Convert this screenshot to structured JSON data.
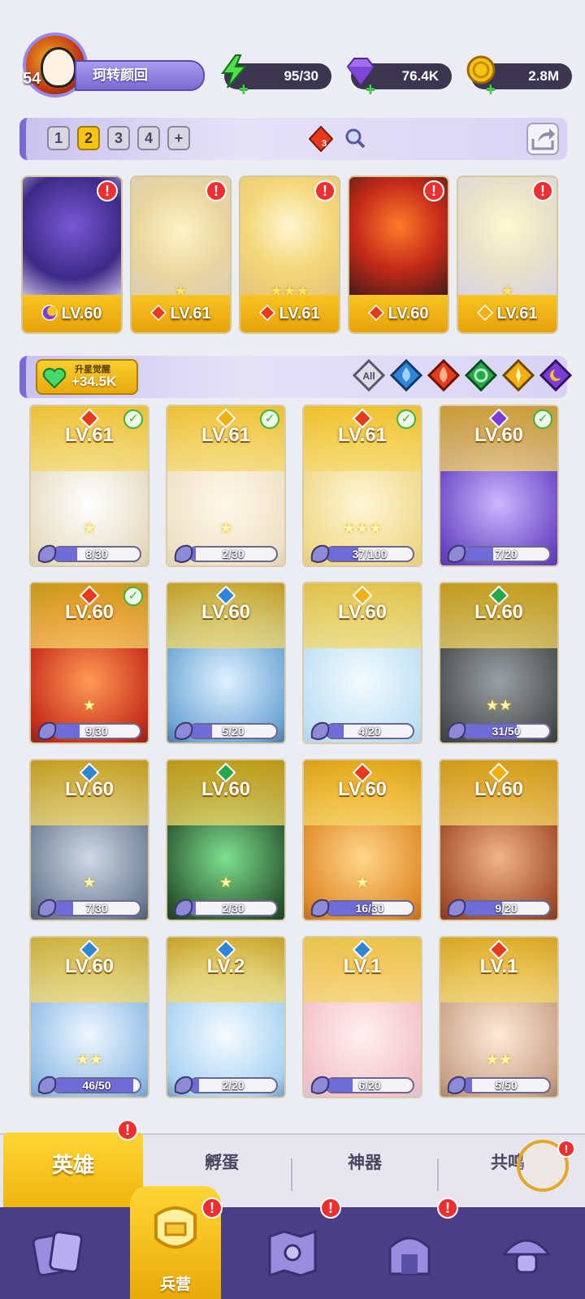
{
  "player": {
    "level": "54",
    "name": "珂转颜回"
  },
  "resources": [
    {
      "name": "energy",
      "icon": "lightning-icon",
      "value": "95/30"
    },
    {
      "name": "gems",
      "icon": "diamond-icon",
      "value": "76.4K"
    },
    {
      "name": "gold",
      "icon": "coin-icon",
      "value": "2.8M"
    }
  ],
  "team_panel": {
    "tabs": [
      "1",
      "2",
      "3",
      "4",
      "+"
    ],
    "active_tab": "2",
    "element_count": "3",
    "members": [
      {
        "element": "dark",
        "level": "LV.60",
        "stars": "",
        "alert": "!"
      },
      {
        "element": "fire",
        "level": "LV.61",
        "stars": "★",
        "alert": "!"
      },
      {
        "element": "fire",
        "level": "LV.61",
        "stars": "★★★",
        "alert": "!"
      },
      {
        "element": "fire",
        "level": "LV.60",
        "stars": "",
        "alert": "!"
      },
      {
        "element": "light",
        "level": "LV.61",
        "stars": "★",
        "alert": "!"
      }
    ]
  },
  "filter": {
    "awake_title": "升星觉醒",
    "awake_value": "+34.5K",
    "all_label": "All",
    "elements": [
      "water",
      "fire",
      "wind",
      "light",
      "dark"
    ]
  },
  "heroes": [
    {
      "element": "fire",
      "level": "LV.61",
      "shards": "8/30",
      "progress": 0.27,
      "checked": true,
      "stars": "★"
    },
    {
      "element": "light",
      "level": "LV.61",
      "shards": "2/30",
      "progress": 0.07,
      "checked": true,
      "stars": "★"
    },
    {
      "element": "fire",
      "level": "LV.61",
      "shards": "37/100",
      "progress": 0.37,
      "checked": true,
      "stars": "★★★"
    },
    {
      "element": "dark",
      "level": "LV.60",
      "shards": "7/20",
      "progress": 0.35,
      "checked": true,
      "stars": ""
    },
    {
      "element": "fire",
      "level": "LV.60",
      "shards": "9/30",
      "progress": 0.3,
      "checked": true,
      "stars": "★"
    },
    {
      "element": "water",
      "level": "LV.60",
      "shards": "5/20",
      "progress": 0.25,
      "checked": false,
      "stars": ""
    },
    {
      "element": "light",
      "level": "LV.60",
      "shards": "4/20",
      "progress": 0.2,
      "checked": false,
      "stars": ""
    },
    {
      "element": "wind",
      "level": "LV.60",
      "shards": "31/50",
      "progress": 0.62,
      "checked": false,
      "stars": "★★"
    },
    {
      "element": "water",
      "level": "LV.60",
      "shards": "7/30",
      "progress": 0.23,
      "checked": false,
      "stars": "★"
    },
    {
      "element": "wind",
      "level": "LV.60",
      "shards": "2/30",
      "progress": 0.07,
      "checked": false,
      "stars": "★"
    },
    {
      "element": "fire",
      "level": "LV.60",
      "shards": "16/30",
      "progress": 0.53,
      "checked": false,
      "stars": "★"
    },
    {
      "element": "light",
      "level": "LV.60",
      "shards": "9/20",
      "progress": 0.45,
      "checked": false,
      "stars": ""
    },
    {
      "element": "water",
      "level": "LV.60",
      "shards": "46/50",
      "progress": 0.92,
      "checked": false,
      "stars": "★★"
    },
    {
      "element": "water",
      "level": "LV.2",
      "shards": "2/20",
      "progress": 0.1,
      "checked": false,
      "stars": ""
    },
    {
      "element": "water",
      "level": "LV.1",
      "shards": "6/20",
      "progress": 0.3,
      "checked": false,
      "stars": ""
    },
    {
      "element": "fire",
      "level": "LV.1",
      "shards": "5/50",
      "progress": 0.1,
      "checked": false,
      "stars": "★★"
    }
  ],
  "sub_tabs": {
    "active": "英雄",
    "items": [
      "孵蛋",
      "神器",
      "共鸣"
    ]
  },
  "bottom_nav": {
    "active_label": "兵营"
  },
  "colors": {
    "fire": "#e53a1c",
    "water": "#2f86d9",
    "wind": "#24a84a",
    "light": "#f2b010",
    "dark": "#7a3dd6",
    "accent": "#f6c514",
    "nav_bg": "#4a3f86"
  }
}
